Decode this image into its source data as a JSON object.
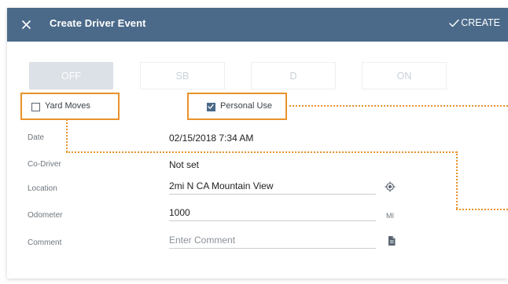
{
  "header": {
    "title": "Create Driver Event",
    "close_icon": "close-icon",
    "create_label": "CREATE",
    "create_icon": "check-icon",
    "bg_color": "#4b6a89"
  },
  "status_buttons": [
    {
      "label": "OFF",
      "selected": true
    },
    {
      "label": "SB",
      "selected": false
    },
    {
      "label": "D",
      "selected": false
    },
    {
      "label": "ON",
      "selected": false
    }
  ],
  "options": {
    "yard_moves": {
      "label": "Yard Moves",
      "checked": false
    },
    "personal_use": {
      "label": "Personal Use",
      "checked": true
    }
  },
  "form": {
    "date": {
      "label": "Date",
      "value": "02/15/2018 7:34 AM"
    },
    "co_driver": {
      "label": "Co-Driver",
      "value": "Not set"
    },
    "location": {
      "label": "Location",
      "value": "2mi N CA Mountain View",
      "icon": "gps-target-icon"
    },
    "odometer": {
      "label": "Odometer",
      "value": "1000",
      "unit": "MI"
    },
    "comment": {
      "label": "Comment",
      "placeholder": "Enter Comment",
      "icon": "document-icon"
    }
  },
  "highlight_color": "#e8922b"
}
